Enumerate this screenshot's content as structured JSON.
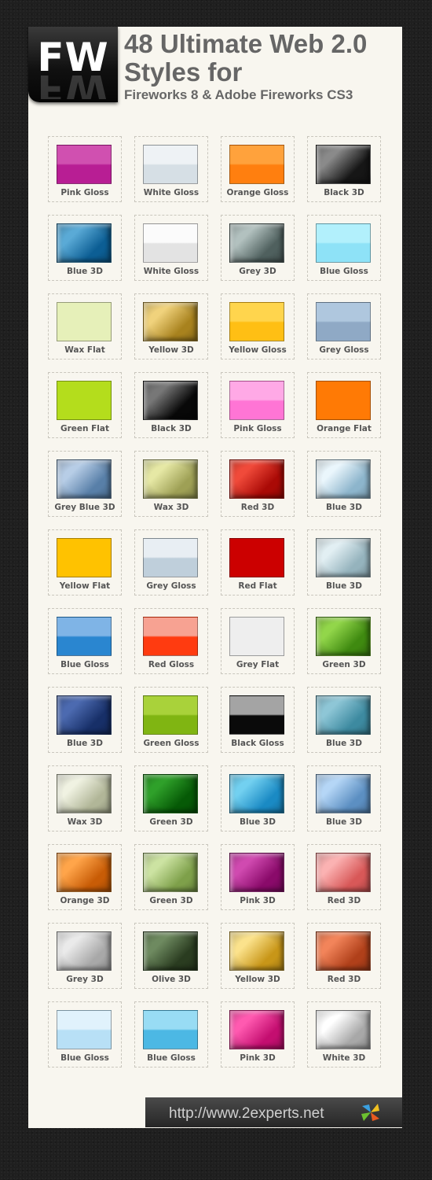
{
  "header": {
    "logo": "FW",
    "title_line1": "48 Ultimate Web 2.0",
    "title_line2": "Styles for",
    "subtitle": "Fireworks 8 & Adobe Fireworks CS3"
  },
  "footer": {
    "url": "http://www.2experts.net",
    "icon": "pinwheel-icon"
  },
  "styles": [
    {
      "label": "Pink Gloss",
      "kind": "gloss",
      "colors": [
        "#d050b0",
        "#b81e94"
      ]
    },
    {
      "label": "White Gloss",
      "kind": "gloss",
      "colors": [
        "#eef2f5",
        "#d6dfe5"
      ]
    },
    {
      "label": "Orange Gloss",
      "kind": "gloss",
      "colors": [
        "#ffa23c",
        "#ff7f0f"
      ]
    },
    {
      "label": "Black 3D",
      "kind": "3d",
      "colors": [
        "#8a8a8a",
        "#161616"
      ]
    },
    {
      "label": "Blue 3D",
      "kind": "3d",
      "colors": [
        "#5aaad6",
        "#0c5e94"
      ]
    },
    {
      "label": "White Gloss",
      "kind": "gloss",
      "colors": [
        "#fbfbfb",
        "#e3e3e3"
      ]
    },
    {
      "label": "Grey 3D",
      "kind": "3d",
      "colors": [
        "#b2c1bf",
        "#4f605e"
      ]
    },
    {
      "label": "Blue Gloss",
      "kind": "gloss",
      "colors": [
        "#b2f0fc",
        "#8ee2f7"
      ]
    },
    {
      "label": "Wax Flat",
      "kind": "flat",
      "colors": [
        "#e6f0b9",
        "#e6f0b9"
      ]
    },
    {
      "label": "Yellow 3D",
      "kind": "3d",
      "colors": [
        "#f0d27c",
        "#a8821e"
      ]
    },
    {
      "label": "Yellow Gloss",
      "kind": "gloss",
      "colors": [
        "#ffd54d",
        "#ffbf14"
      ]
    },
    {
      "label": "Grey Gloss",
      "kind": "gloss",
      "colors": [
        "#afc7de",
        "#8fa9c5"
      ]
    },
    {
      "label": "Green Flat",
      "kind": "flat",
      "colors": [
        "#b4dd1c",
        "#b4dd1c"
      ]
    },
    {
      "label": "Black 3D",
      "kind": "3d",
      "colors": [
        "#777777",
        "#080808"
      ]
    },
    {
      "label": "Pink Gloss",
      "kind": "gloss",
      "colors": [
        "#ffa9e6",
        "#ff75d5"
      ]
    },
    {
      "label": "Orange Flat",
      "kind": "flat",
      "colors": [
        "#ff7a05",
        "#ff7a05"
      ]
    },
    {
      "label": "Grey Blue 3D",
      "kind": "3d",
      "colors": [
        "#b7cde6",
        "#587fa8"
      ]
    },
    {
      "label": "Wax 3D",
      "kind": "3d",
      "colors": [
        "#e6e8a5",
        "#9ea055"
      ]
    },
    {
      "label": "Red 3D",
      "kind": "3d",
      "colors": [
        "#f04a3a",
        "#aa0a06"
      ]
    },
    {
      "label": "Blue 3D",
      "kind": "3d",
      "colors": [
        "#eaf6fc",
        "#8db5cc"
      ]
    },
    {
      "label": "Yellow Flat",
      "kind": "flat",
      "colors": [
        "#ffc200",
        "#ffc200"
      ]
    },
    {
      "label": "Grey Gloss",
      "kind": "gloss",
      "colors": [
        "#e8eef3",
        "#bfcfdb"
      ]
    },
    {
      "label": "Red Flat",
      "kind": "flat",
      "colors": [
        "#cc0000",
        "#cc0000"
      ]
    },
    {
      "label": "Blue 3D",
      "kind": "3d",
      "colors": [
        "#e2eff3",
        "#95b3bd"
      ]
    },
    {
      "label": "Blue Gloss",
      "kind": "gloss",
      "colors": [
        "#7fb4e6",
        "#2a86d0"
      ]
    },
    {
      "label": "Red Gloss",
      "kind": "gloss",
      "colors": [
        "#f7a292",
        "#ff3b10"
      ]
    },
    {
      "label": "Grey Flat",
      "kind": "flat",
      "colors": [
        "#eeeeee",
        "#eeeeee"
      ]
    },
    {
      "label": "Green 3D",
      "kind": "3d",
      "colors": [
        "#92d64a",
        "#3f8a10"
      ]
    },
    {
      "label": "Blue 3D",
      "kind": "3d",
      "colors": [
        "#4c6ab0",
        "#172f68"
      ]
    },
    {
      "label": "Green Gloss",
      "kind": "gloss",
      "colors": [
        "#a9d23a",
        "#80b512"
      ]
    },
    {
      "label": "Black Gloss",
      "kind": "gloss",
      "colors": [
        "#a4a4a4",
        "#0a0a0a"
      ]
    },
    {
      "label": "Blue 3D",
      "kind": "3d",
      "colors": [
        "#8ec6d6",
        "#3d8aa0"
      ]
    },
    {
      "label": "Wax 3D",
      "kind": "3d",
      "colors": [
        "#f0f2e2",
        "#b1b698"
      ]
    },
    {
      "label": "Green 3D",
      "kind": "3d",
      "colors": [
        "#2fa02a",
        "#065a06"
      ]
    },
    {
      "label": "Blue 3D",
      "kind": "3d",
      "colors": [
        "#72d0f0",
        "#1a8ac4"
      ]
    },
    {
      "label": "Blue 3D",
      "kind": "3d",
      "colors": [
        "#b5d6f6",
        "#5c8fc2"
      ]
    },
    {
      "label": "Orange 3D",
      "kind": "3d",
      "colors": [
        "#ffa54a",
        "#c85c06"
      ]
    },
    {
      "label": "Green 3D",
      "kind": "3d",
      "colors": [
        "#cce3a2",
        "#7ea04a"
      ]
    },
    {
      "label": "Pink 3D",
      "kind": "3d",
      "colors": [
        "#d04ab0",
        "#8a0a6a"
      ]
    },
    {
      "label": "Red 3D",
      "kind": "3d",
      "colors": [
        "#fbb2b2",
        "#d85858"
      ]
    },
    {
      "label": "Grey 3D",
      "kind": "3d",
      "colors": [
        "#eaeaea",
        "#a8a8a8"
      ]
    },
    {
      "label": "Olive 3D",
      "kind": "3d",
      "colors": [
        "#6e8a60",
        "#2a3c20"
      ]
    },
    {
      "label": "Yellow 3D",
      "kind": "3d",
      "colors": [
        "#fbe28c",
        "#c89618"
      ]
    },
    {
      "label": "Red 3D",
      "kind": "3d",
      "colors": [
        "#f2845a",
        "#b0401a"
      ]
    },
    {
      "label": "Blue Gloss",
      "kind": "gloss",
      "colors": [
        "#e0f2fc",
        "#b8e0f6"
      ]
    },
    {
      "label": "Blue Gloss",
      "kind": "gloss",
      "colors": [
        "#98dcf4",
        "#4cb8e4"
      ]
    },
    {
      "label": "Pink 3D",
      "kind": "3d",
      "colors": [
        "#ff5ab0",
        "#c40e70"
      ]
    },
    {
      "label": "White 3D",
      "kind": "3d",
      "colors": [
        "#ffffff",
        "#a8a8a8"
      ]
    }
  ]
}
